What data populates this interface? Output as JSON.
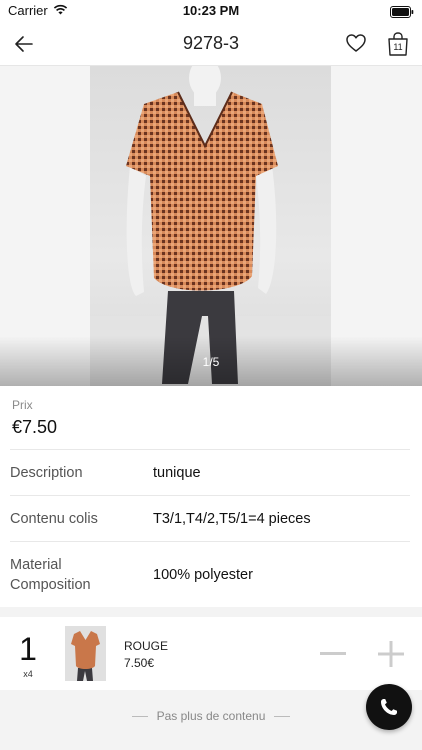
{
  "status_bar": {
    "carrier": "Carrier",
    "time": "10:23 PM"
  },
  "nav": {
    "title": "9278-3",
    "bag_count": "11"
  },
  "gallery": {
    "page_indicator": "1/5"
  },
  "price": {
    "label": "Prix",
    "value": "€7.50"
  },
  "specs": [
    {
      "label": "Description",
      "value": "tunique"
    },
    {
      "label": "Contenu colis",
      "value": "T3/1,T4/2,T5/1=4 pieces"
    },
    {
      "label": "Material Composition",
      "value": "100% polyester"
    }
  ],
  "cart_line": {
    "quantity": "1",
    "multiplier": "x4",
    "color": "ROUGE",
    "price": "7.50€"
  },
  "footer": {
    "no_more_text": "Pas plus de contenu"
  },
  "colors": {
    "accent": "#111111",
    "stepper": "#cccccc",
    "garment": "#c9774a"
  }
}
